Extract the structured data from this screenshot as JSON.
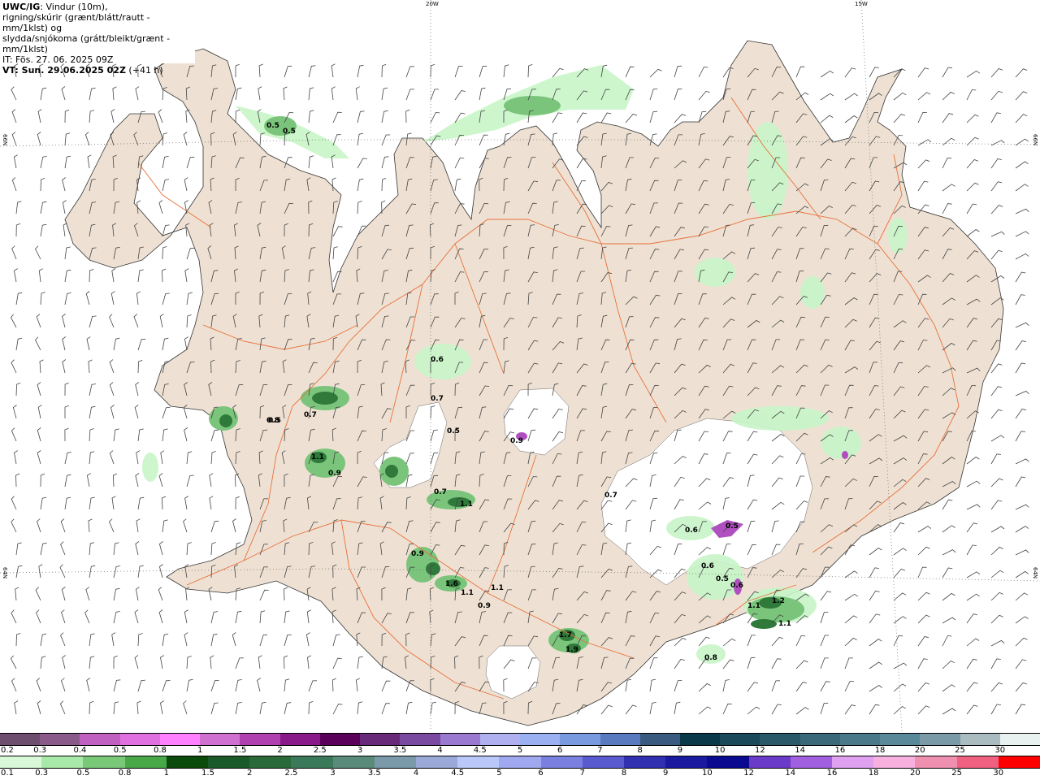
{
  "header": {
    "product": "UWC/IG",
    "description_line1": ": Vindur (10m),",
    "description_line2": "rigning/skúrir (grænt/blátt/rautt - mm/1klst) og",
    "description_line3": "slydda/snjókoma (grátt/bleikt/grænt - mm/1klst)",
    "issue_time": "IT: Fös. 27. 06. 2025 09Z",
    "valid_time": "VT: Sun. 29.06.2025 02Z",
    "lead_time": " (+41 h)"
  },
  "graticule": {
    "lon_labels": [
      "20W",
      "15W"
    ],
    "lat_labels": [
      "66N",
      "64N",
      "66N",
      "64N"
    ]
  },
  "map": {
    "colors": {
      "land": "#eee1d3",
      "sea": "#ffffff",
      "roads": "#e8703a",
      "glacier": "#ffffff",
      "rain_light": "#c8f5c8",
      "rain_mid": "#7bc47b",
      "rain_dark": "#2f7a3a",
      "snow": "#b050c0",
      "barbs": "#555555"
    },
    "precip_values": [
      "0.5",
      "0.5",
      "0.6",
      "0.7",
      "0.5",
      "0.9",
      "0.5",
      "0.8",
      "0.7",
      "1.1",
      "0.9",
      "0.7",
      "1.1",
      "0.7",
      "0.6",
      "0.5",
      "0.9",
      "1.6",
      "1.1",
      "1.1",
      "0.9",
      "0.6",
      "0.5",
      "0.6",
      "1.1",
      "1.2",
      "1.1",
      "1.7",
      "1.9",
      "0.8"
    ]
  },
  "legend_snow": {
    "labels": [
      "0.2",
      "0.3",
      "0.4",
      "0.5",
      "0.8",
      "1",
      "1.5",
      "2",
      "2.5",
      "3",
      "3.5",
      "4",
      "4.5",
      "5",
      "6",
      "7",
      "8",
      "9",
      "10",
      "12",
      "14",
      "16",
      "18",
      "20",
      "25",
      "30"
    ],
    "colors": [
      "#6e4e6e",
      "#8a5a8a",
      "#c060c0",
      "#e070e0",
      "#ff80ff",
      "#d070d0",
      "#b040b0",
      "#8a1a8a",
      "#5a005a",
      "#6a2a7a",
      "#7a4aa0",
      "#9a7ad0",
      "#b0b0f0",
      "#9ab0f0",
      "#7a9ae0",
      "#5a7ac0",
      "#3a5a80",
      "#0a3a4a",
      "#1a4a5a",
      "#2a5a6a",
      "#3a6a7a",
      "#4a7a8a",
      "#5a8a9a",
      "#7a9aa8",
      "#aabcc0",
      "#e8f0f0"
    ]
  },
  "legend_rain": {
    "labels": [
      "0.1",
      "0.3",
      "0.5",
      "0.8",
      "1",
      "1.5",
      "2",
      "2.5",
      "3",
      "3.5",
      "4",
      "4.5",
      "5",
      "6",
      "7",
      "8",
      "9",
      "10",
      "12",
      "14",
      "16",
      "18",
      "20",
      "25",
      "30"
    ],
    "colors": [
      "#d8f8d8",
      "#a8e8a8",
      "#78c878",
      "#48a848",
      "#0a4a0a",
      "#1a5a2a",
      "#2a6a3a",
      "#3a7a5a",
      "#5a8a7a",
      "#7a9aaa",
      "#9aaad8",
      "#b8c8f8",
      "#a0a8f0",
      "#7a80e0",
      "#5a5ad0",
      "#3030b0",
      "#1a1aa0",
      "#0a0a90",
      "#6a3ac8",
      "#a060e0",
      "#e0a0f0",
      "#f8b0e0",
      "#f090b0",
      "#f06080",
      "#ff0000"
    ]
  }
}
